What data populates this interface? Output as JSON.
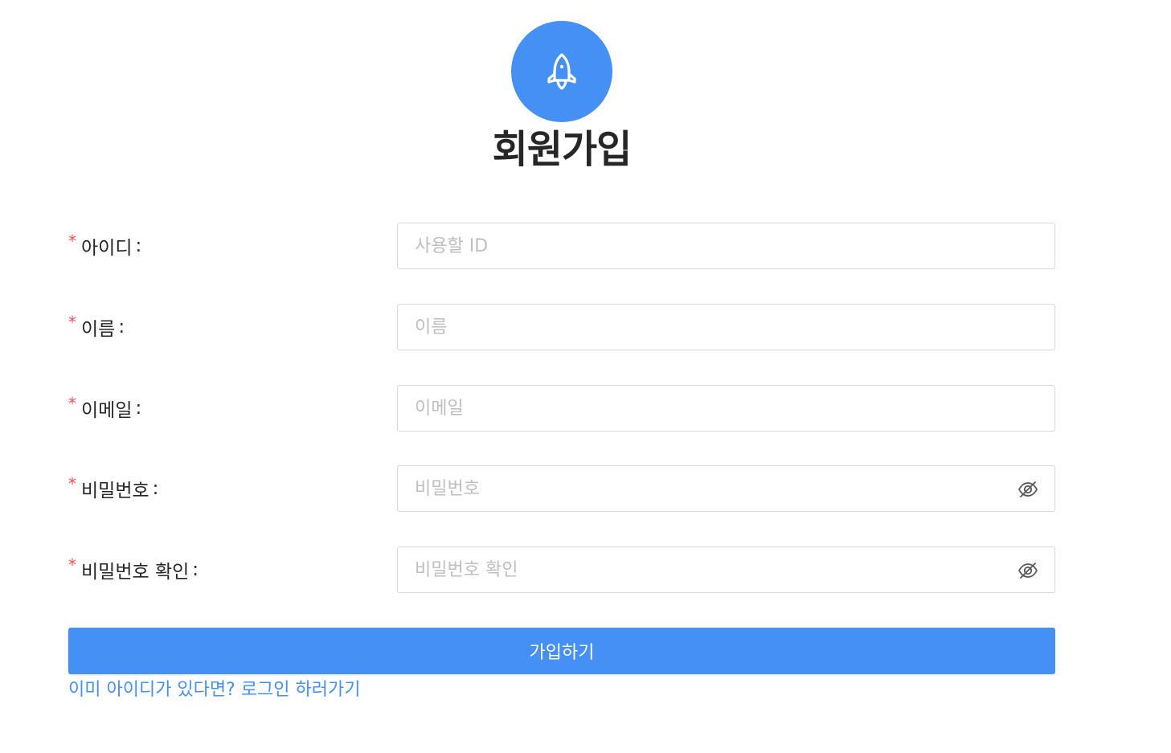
{
  "brand": {
    "logo_icon": "rocket-icon",
    "accent_color": "#4590f5"
  },
  "page": {
    "title": "회원가입"
  },
  "form": {
    "fields": [
      {
        "label": "아이디",
        "colon": ":",
        "required_mark": "*",
        "placeholder": "사용할 ID",
        "value": ""
      },
      {
        "label": "이름",
        "colon": ":",
        "required_mark": "*",
        "placeholder": "이름",
        "value": ""
      },
      {
        "label": "이메일",
        "colon": ":",
        "required_mark": "*",
        "placeholder": "이메일",
        "value": ""
      },
      {
        "label": "비밀번호",
        "colon": ":",
        "required_mark": "*",
        "placeholder": "비밀번호",
        "value": "",
        "toggle_icon": "eye-invisible-icon"
      },
      {
        "label": "비밀번호 확인",
        "colon": ":",
        "required_mark": "*",
        "placeholder": "비밀번호 확인",
        "value": "",
        "toggle_icon": "eye-invisible-icon"
      }
    ],
    "submit_label": "가입하기",
    "login_link_text": "이미 아이디가 있다면? 로그인 하러가기"
  }
}
